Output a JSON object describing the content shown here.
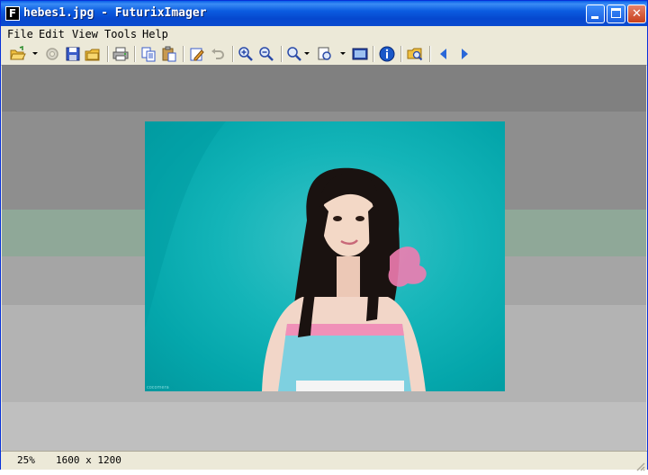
{
  "window": {
    "title": "hebes1.jpg - FuturixImager",
    "app_icon_letter": "F"
  },
  "menu": {
    "items": [
      "File",
      "Edit",
      "View",
      "Tools",
      "Help"
    ]
  },
  "toolbar": {
    "buttons": [
      "open-icon",
      "refresh-icon",
      "save-icon",
      "open-folder-icon",
      "print-icon",
      "copy-icon",
      "paste-icon",
      "edit-icon",
      "undo-icon",
      "zoom-in-icon",
      "zoom-out-icon",
      "zoom-icon",
      "adjust-icon",
      "fullscreen-icon",
      "info-icon",
      "browse-icon",
      "previous-icon",
      "next-icon"
    ]
  },
  "image": {
    "watermark": "cocomera"
  },
  "status": {
    "zoom": "25%",
    "dimensions": "1600 x 1200"
  },
  "colors": {
    "titlebar": "#0a5fe8",
    "image_bg": "#13b4b8",
    "viewer_band_dark": "#808080",
    "viewer_band_green": "#8fa898"
  }
}
